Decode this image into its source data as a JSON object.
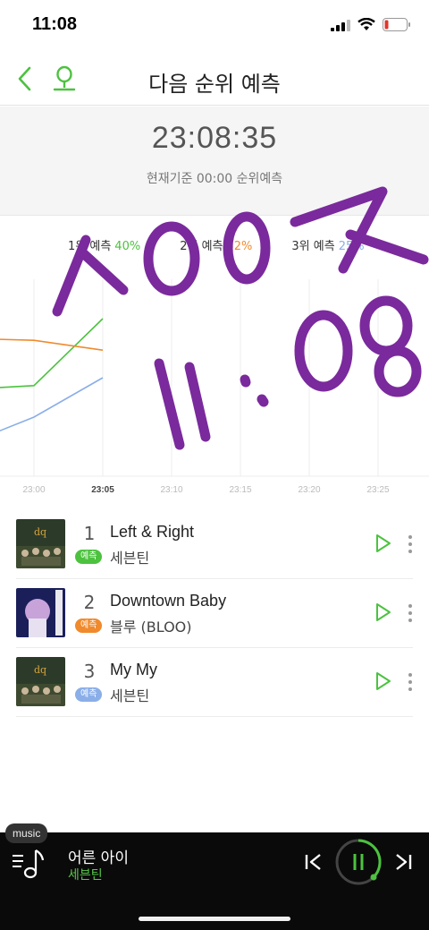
{
  "status": {
    "time": "11:08"
  },
  "nav": {
    "title": "다음 순위 예측",
    "back_icon": "back-chevron-icon",
    "voice_icon": "microphone-icon"
  },
  "timer": {
    "clock": "23:08:35",
    "subtitle": "현재기준 00:00 순위예측"
  },
  "legend": [
    {
      "label": "1위 예측",
      "pct": "40%",
      "color": "#4cc23f"
    },
    {
      "label": "2위 예측",
      "pct": "32%",
      "color": "#f08a2c"
    },
    {
      "label": "3위 예측",
      "pct": "25%",
      "color": "#8aaee8"
    }
  ],
  "chart_data": {
    "type": "line",
    "x": [
      "23:00",
      "23:05",
      "23:10",
      "23:15",
      "23:20",
      "23:25"
    ],
    "highlight_tick": "23:05",
    "series": [
      {
        "name": "1위 예측",
        "color": "#4cc23f",
        "points": [
          [
            22.5,
            22
          ],
          [
            23.0,
            23
          ],
          [
            23.5,
            40
          ]
        ]
      },
      {
        "name": "2위 예측",
        "color": "#f08a2c",
        "points": [
          [
            22.5,
            35
          ],
          [
            23.0,
            34.5
          ],
          [
            23.5,
            32
          ]
        ]
      },
      {
        "name": "3위 예측",
        "color": "#8aaee8",
        "points": [
          [
            22.5,
            8
          ],
          [
            23.0,
            15
          ],
          [
            23.5,
            25
          ]
        ]
      }
    ],
    "ylim": [
      0,
      50
    ],
    "grid": true
  },
  "songs": [
    {
      "rank": "1",
      "title": "Left & Right",
      "badge": "예측",
      "badge_color": "#4cc23f",
      "artist": "세븐틴"
    },
    {
      "rank": "2",
      "title": "Downtown Baby",
      "badge": "예측",
      "badge_color": "#f08a2c",
      "artist": "블루 (BLOO)"
    },
    {
      "rank": "3",
      "title": "My My",
      "badge": "예측",
      "badge_color": "#8aaee8",
      "artist": "세븐틴"
    }
  ],
  "player": {
    "badge": "music",
    "title": "어른 아이",
    "artist": "세븐틴"
  },
  "accent": "#4cc23f",
  "annotation": {
    "line1": "ㅅOO7",
    "line2": "11:08",
    "color": "#7a2a9c"
  }
}
